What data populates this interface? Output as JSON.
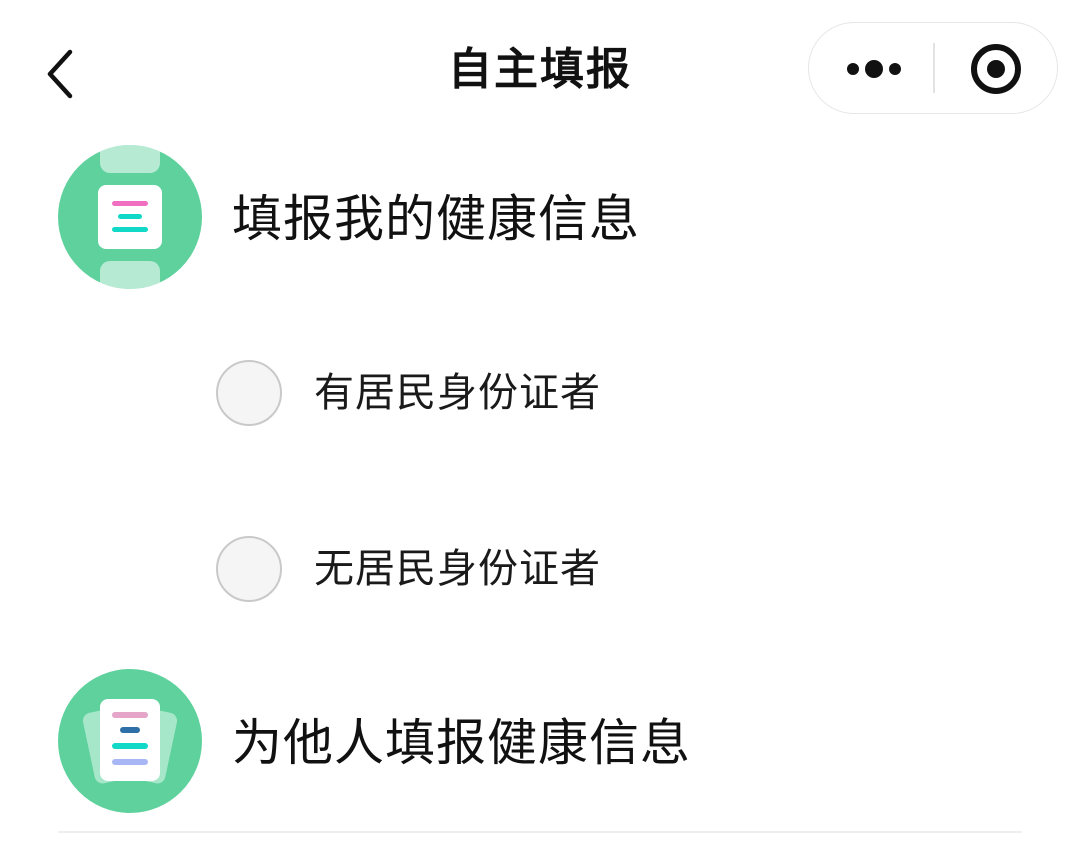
{
  "nav": {
    "title": "自主填报",
    "back_icon": "chevron-left-icon",
    "more_icon": "more-dots-icon",
    "close_icon": "target-circle-icon"
  },
  "sections": [
    {
      "label": "填报我的健康信息",
      "icon": "health-form-icon",
      "options": [
        {
          "label": "有居民身份证者",
          "selected": false
        },
        {
          "label": "无居民身份证者",
          "selected": false
        }
      ]
    },
    {
      "label": "为他人填报健康信息",
      "icon": "health-form-others-icon"
    }
  ],
  "colors": {
    "icon_bg": "#5ed19d",
    "accent_pink": "#f06fc0",
    "accent_cyan": "#12d8c8",
    "accent_blue": "#2f6fa8",
    "accent_lavender": "#a9b6f5",
    "text": "#111111"
  }
}
